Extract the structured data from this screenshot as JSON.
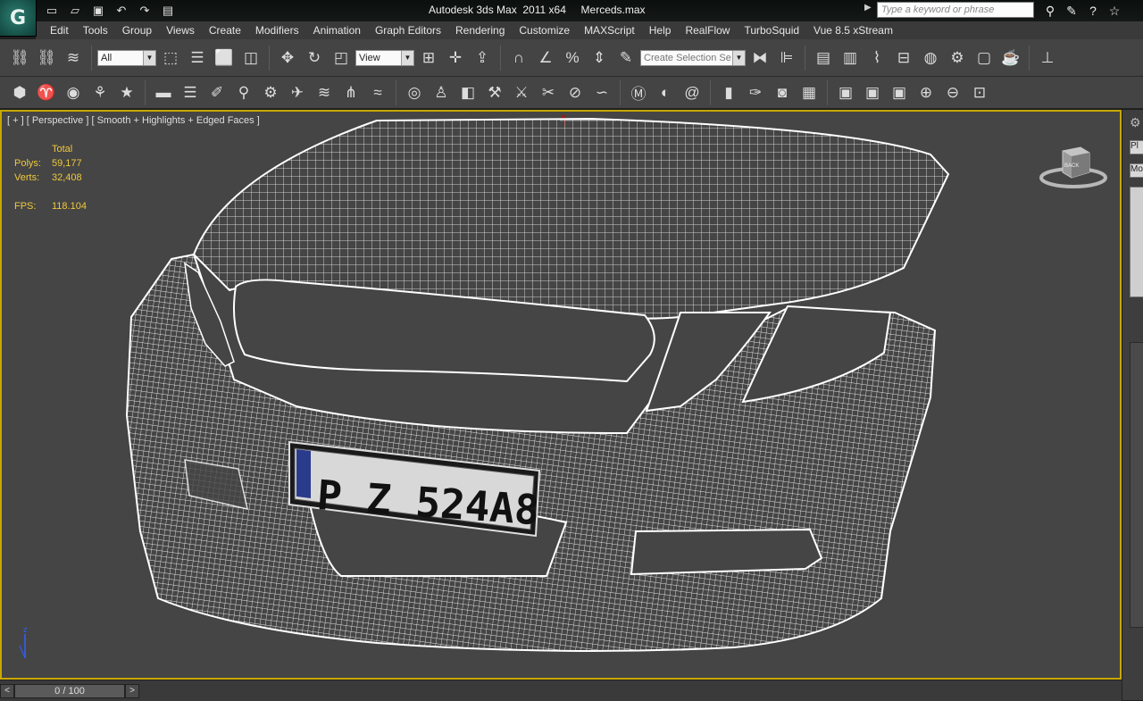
{
  "titlebar": {
    "title": "Autodesk 3ds Max  2011 x64     Merceds.max",
    "search_placeholder": "Type a keyword or phrase",
    "quick_access": [
      "new-icon",
      "open-icon",
      "save-icon",
      "undo-icon",
      "redo-icon",
      "project-folder-icon"
    ],
    "right_icons": [
      "binoculars-icon",
      "community-icon",
      "help-icon",
      "star-icon"
    ]
  },
  "menu": {
    "items": [
      "Edit",
      "Tools",
      "Group",
      "Views",
      "Create",
      "Modifiers",
      "Animation",
      "Graph Editors",
      "Rendering",
      "Customize",
      "MAXScript",
      "Help",
      "RealFlow",
      "TurboSquid",
      "Vue 8.5 xStream"
    ]
  },
  "main_toolbar": {
    "selection_filter": "All",
    "reference_coord": "View",
    "named_selection_placeholder": "Create Selection Se"
  },
  "viewport": {
    "label": "[ + ] [ Perspective ] [ Smooth + Highlights + Edged Faces ]",
    "stats": {
      "header": "Total",
      "polys_label": "Polys:",
      "polys_value": "59,177",
      "verts_label": "Verts:",
      "verts_value": "32,408",
      "fps_label": "FPS:",
      "fps_value": "118.104"
    },
    "license_plate": "P Z 524A8",
    "viewcube_label": "BACK",
    "axis_label": "z"
  },
  "timeline": {
    "frame": "0 / 100",
    "prev": "<",
    "next": ">"
  },
  "colors": {
    "viewport_bg": "#454545",
    "viewport_border": "#c8a800",
    "stats": "#f0c93a",
    "ui_bg": "#444444"
  }
}
